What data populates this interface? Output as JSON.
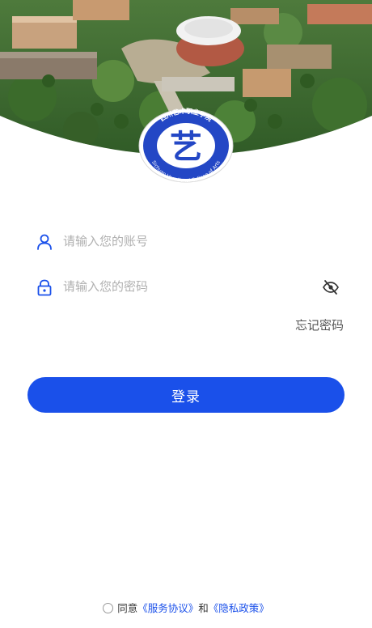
{
  "logo": {
    "school_name_cn": "四川艺术职业学院",
    "school_name_en": "Sichuan Vocational College of Arts",
    "emblem_char": "艺"
  },
  "login_form": {
    "account_placeholder": "请输入您的账号",
    "password_placeholder": "请输入您的密码",
    "forgot_password": "忘记密码",
    "login_button": "登录"
  },
  "agreement": {
    "prefix": "同意",
    "service_link": "《服务协议》",
    "conjunction": "和",
    "privacy_link": "《隐私政策》"
  },
  "icons": {
    "account": "user-icon",
    "password": "lock-icon",
    "toggle": "eye-off-icon"
  },
  "colors": {
    "accent": "#1a50ea",
    "emblem_blue": "#2347c5",
    "placeholder": "#b0b0b0"
  }
}
